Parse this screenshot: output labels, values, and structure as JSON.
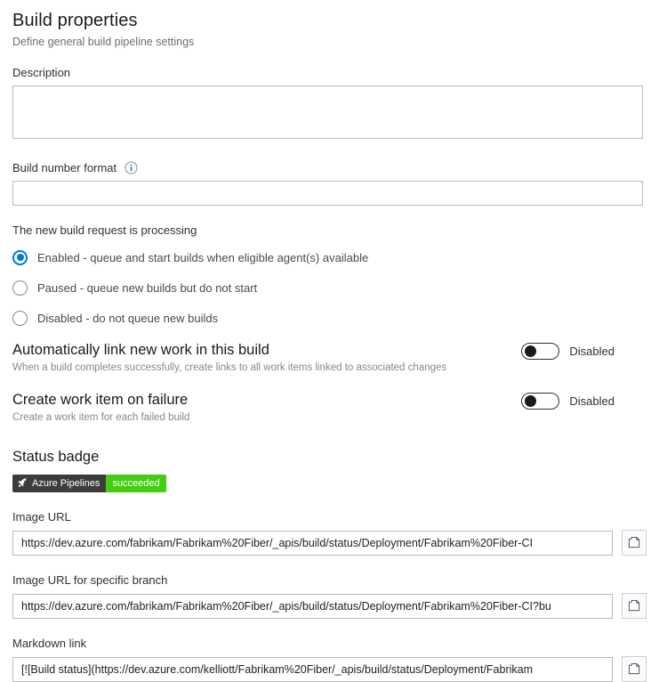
{
  "header": {
    "title": "Build properties",
    "subtitle": "Define general build pipeline settings"
  },
  "description": {
    "label": "Description",
    "value": "",
    "placeholder": ""
  },
  "build_number_format": {
    "label": "Build number format",
    "info_icon": "info-icon",
    "value": "",
    "placeholder": ""
  },
  "processing": {
    "label": "The new build request is processing",
    "selected": "enabled",
    "options": [
      {
        "id": "enabled",
        "label": "Enabled - queue and start builds when eligible agent(s) available",
        "checked": true
      },
      {
        "id": "paused",
        "label": "Paused - queue new builds but do not start",
        "checked": false
      },
      {
        "id": "disabled",
        "label": "Disabled - do not queue new builds",
        "checked": false
      }
    ]
  },
  "auto_link": {
    "heading": "Automatically link new work in this build",
    "description": "When a build completes successfully, create links to all work items linked to associated changes",
    "toggle_state": "Disabled"
  },
  "work_item_failure": {
    "heading": "Create work item on failure",
    "description": "Create a work item for each failed build",
    "toggle_state": "Disabled"
  },
  "status_badge": {
    "heading": "Status badge",
    "badge_icon": "rocket-icon",
    "badge_left_text": "Azure Pipelines",
    "badge_right_text": "succeeded",
    "badge_left_color": "#3c3c3c",
    "badge_right_color": "#44cc11"
  },
  "image_url": {
    "label": "Image URL",
    "value": "https://dev.azure.com/fabrikam/Fabrikam%20Fiber/_apis/build/status/Deployment/Fabrikam%20Fiber-CI",
    "copy_icon": "copy-icon"
  },
  "image_url_branch": {
    "label": "Image URL for specific branch",
    "value": "https://dev.azure.com/fabrikam/Fabrikam%20Fiber/_apis/build/status/Deployment/Fabrikam%20Fiber-CI?bu",
    "copy_icon": "copy-icon"
  },
  "markdown_link": {
    "label": "Markdown link",
    "value": "[![Build status](https://dev.azure.com/kelliott/Fabrikam%20Fiber/_apis/build/status/Deployment/Fabrikam",
    "copy_icon": "copy-icon"
  },
  "colors": {
    "accent": "#0078d4",
    "badge_success": "#44cc11",
    "badge_label": "#3c3c3c"
  }
}
